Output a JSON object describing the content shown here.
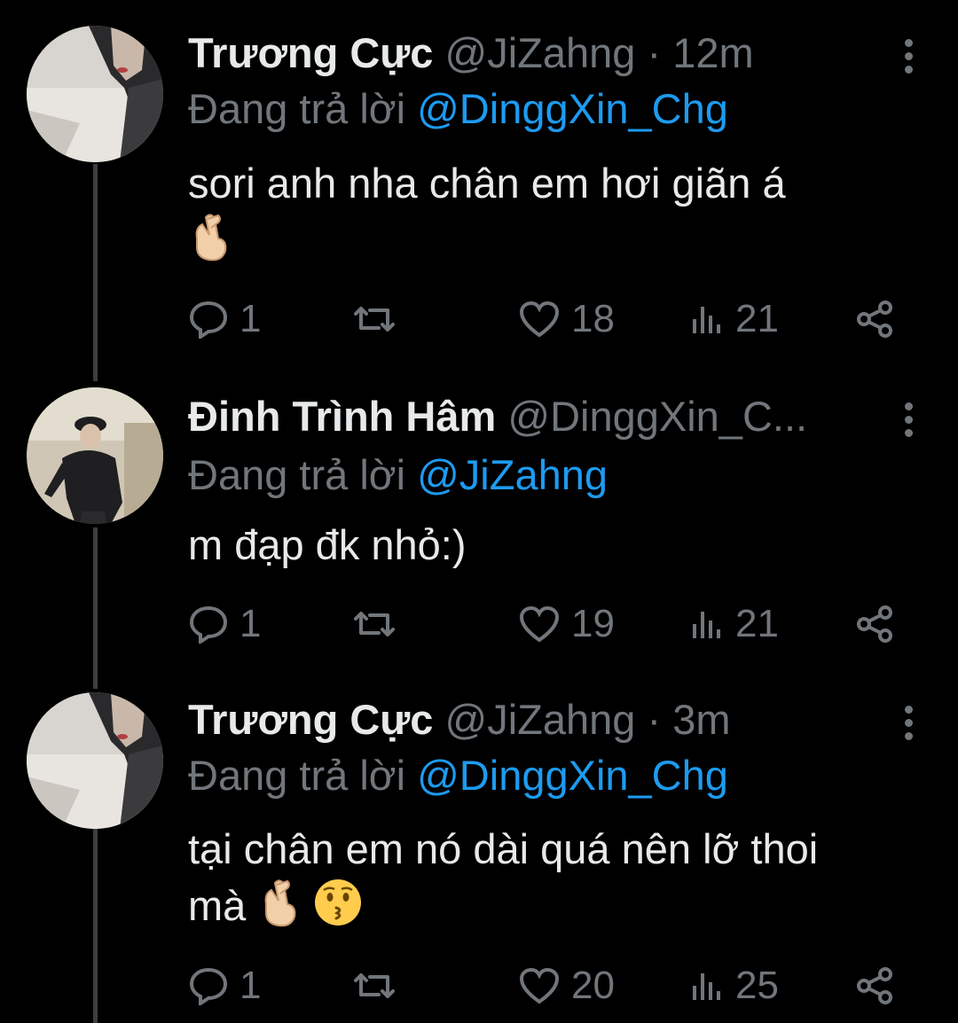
{
  "colors": {
    "background": "#000000",
    "text": "#e7e9ea",
    "muted": "#71767b",
    "link": "#1d9bf0",
    "thread_line": "#3a3f44"
  },
  "replying_label": "Đang trả lời",
  "tweets": [
    {
      "name": "Trương Cực",
      "handle": "@JiZahng",
      "sep": "·",
      "time": "12m",
      "reply_to": "@DinggXin_Chg",
      "text": "sori anh nha chân em hơi giãn á",
      "emoji": [
        "crossed-fingers-icon"
      ],
      "replies": "1",
      "retweets": "",
      "likes": "18",
      "views": "21"
    },
    {
      "name": "Đinh Trình Hâm",
      "handle": "@DinggXin_C...",
      "sep": "",
      "time": "",
      "reply_to": "@JiZahng",
      "text": "m đạp đk nhỏ:)",
      "emoji": [],
      "replies": "1",
      "retweets": "",
      "likes": "19",
      "views": "21"
    },
    {
      "name": "Trương Cực",
      "handle": "@JiZahng",
      "sep": "·",
      "time": "3m",
      "reply_to": "@DinggXin_Chg",
      "text_line1": "tại chân em nó dài quá nên lỡ thoi",
      "text_line2": "mà",
      "emoji": [
        "crossed-fingers-icon",
        "kissing-face-icon"
      ],
      "replies": "1",
      "retweets": "",
      "likes": "20",
      "views": "25"
    }
  ]
}
